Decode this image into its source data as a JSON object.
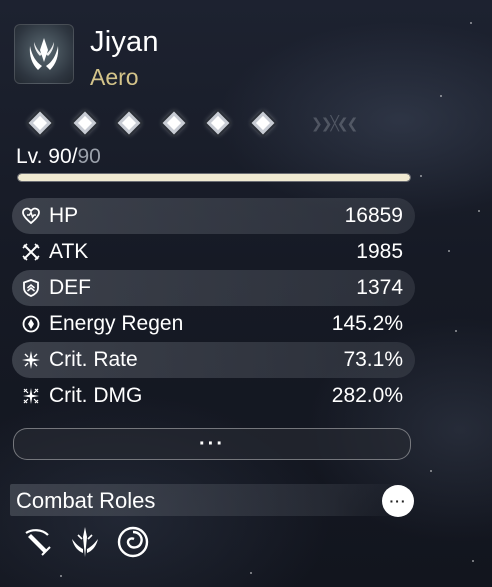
{
  "character": {
    "name": "Jiyan",
    "element": "Aero",
    "element_icon": "aero-element-icon",
    "accent_color": "#d4c48a"
  },
  "resonance_chain": {
    "nodes": [
      {
        "active": true
      },
      {
        "active": true
      },
      {
        "active": true
      },
      {
        "active": true
      },
      {
        "active": true
      },
      {
        "active": true
      }
    ]
  },
  "level": {
    "label": "Lv. 90/",
    "max": "90",
    "progress": 1.0
  },
  "stats": [
    {
      "label": "HP",
      "value": "16859",
      "icon": "hp-heart-icon"
    },
    {
      "label": "ATK",
      "value": "1985",
      "icon": "atk-crossed-swords-icon"
    },
    {
      "label": "DEF",
      "value": "1374",
      "icon": "def-shield-icon"
    },
    {
      "label": "Energy Regen",
      "value": "145.2%",
      "icon": "energy-regen-icon"
    },
    {
      "label": "Crit. Rate",
      "value": "73.1%",
      "icon": "crit-rate-icon"
    },
    {
      "label": "Crit. DMG",
      "value": "282.0%",
      "icon": "crit-dmg-icon"
    }
  ],
  "more_button": {
    "label": "···"
  },
  "combat_roles": {
    "title": "Combat Roles",
    "more_label": "···",
    "roles": [
      {
        "icon": "heavy-attack-sword-icon"
      },
      {
        "icon": "resonance-liberation-icon"
      },
      {
        "icon": "aero-swirl-icon"
      }
    ]
  }
}
